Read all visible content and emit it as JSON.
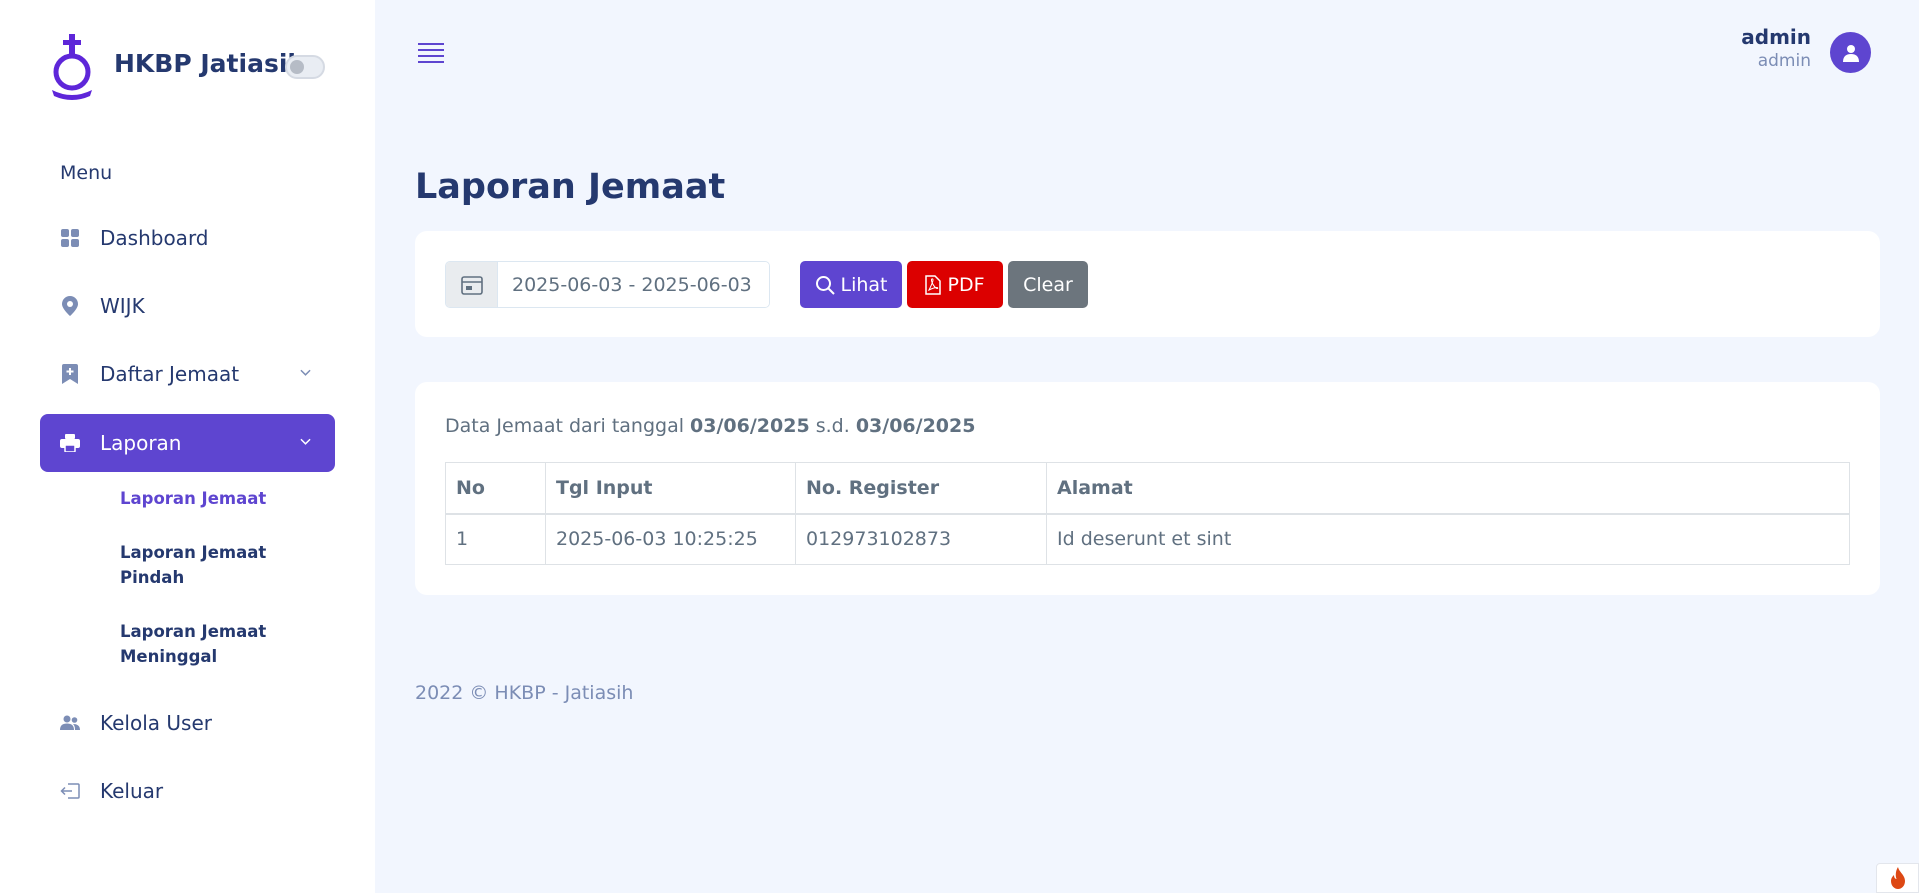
{
  "brand": {
    "title": "HKBP Jatiasih"
  },
  "sidebar": {
    "menu_title": "Menu",
    "items": [
      {
        "label": "Dashboard",
        "icon": "grid-icon"
      },
      {
        "label": "WIJK",
        "icon": "map-pin-icon"
      },
      {
        "label": "Daftar Jemaat",
        "icon": "bookmark-plus-icon"
      },
      {
        "label": "Laporan",
        "icon": "printer-icon",
        "active": true
      },
      {
        "label": "Kelola User",
        "icon": "users-icon"
      },
      {
        "label": "Keluar",
        "icon": "logout-icon"
      }
    ],
    "submenu": [
      {
        "label": "Laporan Jemaat",
        "active": true
      },
      {
        "label": "Laporan Jemaat Pindah"
      },
      {
        "label": "Laporan Jemaat Meninggal"
      }
    ]
  },
  "header": {
    "user_name": "admin",
    "user_role": "admin"
  },
  "page": {
    "title": "Laporan Jemaat"
  },
  "filter": {
    "date_range_value": "2025-06-03 - 2025-06-03",
    "lihat_label": "Lihat",
    "pdf_label": "PDF",
    "clear_label": "Clear"
  },
  "report": {
    "caption_prefix": "Data Jemaat dari tanggal",
    "date_from": "03/06/2025",
    "caption_mid": "s.d.",
    "date_to": "03/06/2025",
    "columns": [
      "No",
      "Tgl Input",
      "No. Register",
      "Alamat"
    ],
    "rows": [
      [
        "1",
        "2025-06-03 10:25:25",
        "012973102873",
        "Id deserunt et sint"
      ]
    ]
  },
  "footer": {
    "text": "2022 © HKBP - Jatiasih"
  },
  "colors": {
    "primary": "#5e45d0",
    "danger": "#dc0000",
    "secondary": "#6c757d",
    "text": "#25396f"
  }
}
